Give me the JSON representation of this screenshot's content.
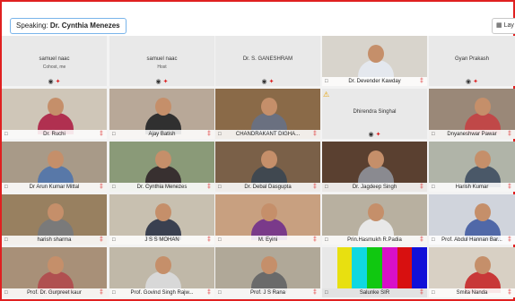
{
  "speaking": {
    "label": "Speaking:",
    "name": "Dr. Cynthia Menezes"
  },
  "layout_button": "Lay",
  "tiles": [
    {
      "name": "samuel naac",
      "sub": "Cohost, me",
      "blank": true
    },
    {
      "name": "samuel naac",
      "sub": "Host",
      "blank": true
    },
    {
      "name": "Dr. S. GANESHRAM",
      "sub": "",
      "blank": true
    },
    {
      "name": "Dr. Devender Kawday",
      "wall": "#d8d4cc",
      "shirt": "#e4e8ee"
    },
    {
      "name": "Gyan Prakash",
      "sub": "",
      "blank": true
    },
    {
      "name": "Dr. Ruchi",
      "wall": "#cfc6b8",
      "shirt": "#b03050"
    },
    {
      "name": "Ajay Batish",
      "wall": "#b8a898",
      "shirt": "#303030"
    },
    {
      "name": "CHANDRAKANT DIGHA...",
      "wall": "#8a6a48",
      "shirt": "#6a7080"
    },
    {
      "name": "Dhirendra Singhal",
      "sub": "",
      "blank": true,
      "warn": true
    },
    {
      "name": "Dnyaneshwar Pawar",
      "wall": "#9a8878",
      "shirt": "#c04848"
    },
    {
      "name": "Dr Arun Kumar Mittal",
      "wall": "#a89a88",
      "shirt": "#5878a8"
    },
    {
      "name": "Dr. Cynthia Menezes",
      "wall": "#8a9a78",
      "shirt": "#383030",
      "active": true
    },
    {
      "name": "Dr. Debal Dasgupta",
      "wall": "#7a6048",
      "shirt": "#404850"
    },
    {
      "name": "Dr. Jagdeep Singh",
      "wall": "#5a4030",
      "shirt": "#8a8a90"
    },
    {
      "name": "Harish Kumar",
      "wall": "#b0b4a8",
      "shirt": "#4a5868"
    },
    {
      "name": "harish sharma",
      "wall": "#988060",
      "shirt": "#7a7a7a"
    },
    {
      "name": "J S S MOHAN",
      "wall": "#c8c0b0",
      "shirt": "#3a4050"
    },
    {
      "name": "M. Eyini",
      "wall": "#c8a080",
      "shirt": "#7a3a8a"
    },
    {
      "name": "Prin.Hasmukh R.Padia",
      "wall": "#b8b0a0",
      "shirt": "#e8e8e8"
    },
    {
      "name": "Prof. Abdul Hannan Bar...",
      "wall": "#d0d4dc",
      "shirt": "#5068a8"
    },
    {
      "name": "Prof. Dr. Gurpreet kaur",
      "wall": "#a89078",
      "shirt": "#b05050"
    },
    {
      "name": "Prof. Govind Singh Rajw...",
      "wall": "#c0b8a8",
      "shirt": "#d8d8d8"
    },
    {
      "name": "Prof. J S Rana",
      "wall": "#b0a898",
      "shirt": "#6a6a6a"
    },
    {
      "name": "Salunke SIR",
      "bars": true
    },
    {
      "name": "Smita Nanda",
      "wall": "#d8d0c4",
      "shirt": "#c83838"
    }
  ],
  "colors": {
    "frame": "#e02020",
    "active": "#2bb0e6",
    "mic_muted": "#d22222"
  }
}
